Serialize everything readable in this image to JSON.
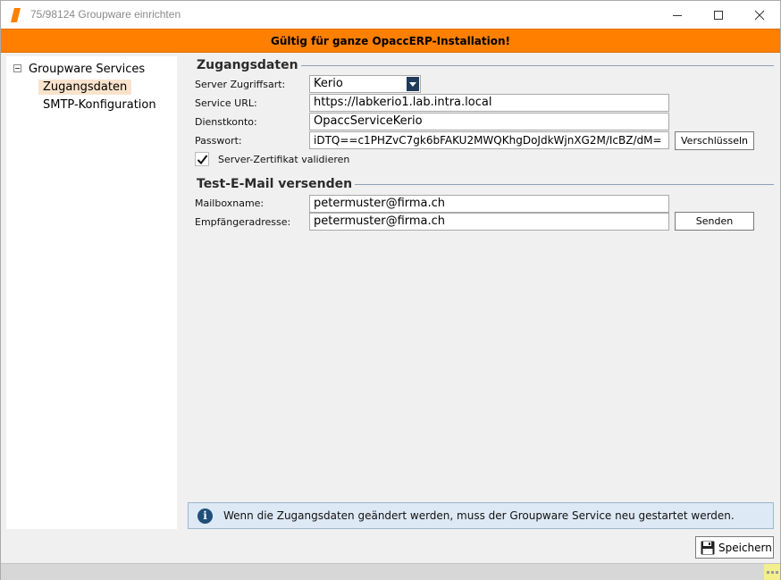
{
  "window": {
    "title": "75/98124 Groupware einrichten",
    "accent_color": "#ff7f00"
  },
  "banner": {
    "text": "Gültig für ganze OpaccERP-Installation!"
  },
  "tree": {
    "root_label": "Groupware Services",
    "items": [
      {
        "label": "Zugangsdaten",
        "selected": true
      },
      {
        "label": "SMTP-Konfiguration",
        "selected": false
      }
    ]
  },
  "access": {
    "title": "Zugangsdaten",
    "server_type_label": "Server Zugriffsart:",
    "server_type_value": "Kerio",
    "service_url_label": "Service URL:",
    "service_url_value": "https://labkerio1.lab.intra.local",
    "service_account_label": "Dienstkonto:",
    "service_account_value": "OpaccServiceKerio",
    "password_label": "Passwort:",
    "password_value": "iDTQ==c1PHZvC7gk6bFAKU2MWQKhgDoJdkWjnXG2M/IcBZ/dM=",
    "encrypt_button": "Verschlüsseln",
    "validate_cert_label": "Server-Zertifikat validieren",
    "validate_cert_checked": true
  },
  "test_mail": {
    "title": "Test-E-Mail versenden",
    "mailbox_label": "Mailboxname:",
    "mailbox_value": "petermuster@firma.ch",
    "recipient_label": "Empfängeradresse:",
    "recipient_value": "petermuster@firma.ch",
    "send_button": "Senden"
  },
  "info": {
    "icon": "info-icon",
    "text": "Wenn die Zugangsdaten geändert werden, muss der Groupware Service neu gestartet werden."
  },
  "footer": {
    "save_button": "Speichern",
    "save_icon": "floppy-disk-icon"
  }
}
